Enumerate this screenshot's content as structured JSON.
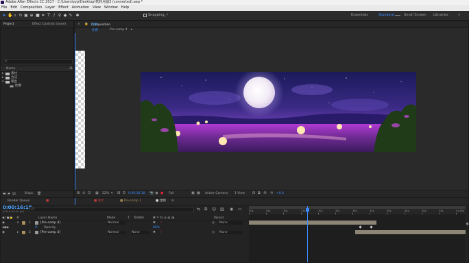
{
  "window": {
    "title": "Adobe After Effects CC 2017 - C:\\Users\\zyp\\Desktop\\花好月圆3 (converted).aep *"
  },
  "menu": [
    "File",
    "Edit",
    "Composition",
    "Layer",
    "Effect",
    "Animation",
    "View",
    "Window",
    "Help"
  ],
  "toolbar": {
    "snapping_label": "Snapping",
    "workspaces": [
      "Essentials",
      "Standard",
      "Small Screen",
      "Libraries"
    ],
    "active_workspace": "Standard"
  },
  "project_panel": {
    "tab_project": "Project",
    "tab_effect_controls": "Effect Controls (none)",
    "search_placeholder": "ρ-",
    "column_name": "Name",
    "items": [
      {
        "label": "素材",
        "type": "folder"
      },
      {
        "label": "合成",
        "type": "folder"
      },
      {
        "label": "输出",
        "type": "folder"
      },
      {
        "label": "比例",
        "type": "comp"
      }
    ],
    "bpc_label": "8 bpc"
  },
  "composition_panel": {
    "tab_label": "Composition",
    "comp_name": "比例",
    "breadcrumb_active": "比例",
    "breadcrumb_next": "Pre-comp 4",
    "zoom": "22%",
    "timecode": "0:00:16:18",
    "resolution": "Full",
    "camera": "Active Camera",
    "views": "1 View",
    "exposure": "+0.0"
  },
  "timeline": {
    "tabs": [
      {
        "label": "Render Queue"
      },
      {
        "label": "■"
      },
      {
        "label": "■ 英文"
      },
      {
        "label": "■ Pre-comp 1"
      },
      {
        "label": "■ 比例",
        "active": true
      }
    ],
    "timecode": "0:00:16:18",
    "frame_info": "00418 (25.00 fps)",
    "search_placeholder": "ρ-",
    "columns": {
      "layer_name": "Layer Name",
      "mode": "Mode",
      "trkmat": "TrkMat",
      "parent": "Parent"
    },
    "layers": [
      {
        "num": "1",
        "name": "[Pre-comp 4]",
        "mode": "Normal",
        "trkmat": "",
        "parent": "None"
      },
      {
        "num": "",
        "name": "Opacity",
        "value": "89%",
        "property": true
      },
      {
        "num": "2",
        "name": "[Pre-comp 4]",
        "mode": "Normal",
        "trkmat": "None",
        "parent": "None"
      }
    ],
    "ruler_ticks": [
      "00s",
      "05s",
      "10s",
      "15s",
      "20s",
      "25s",
      "30s",
      "35s",
      "40s",
      "45s",
      "50s",
      "55s",
      "01:00s"
    ],
    "current_time_fraction": 0.27,
    "layer_bars": [
      {
        "start_fraction": 0.0,
        "end_fraction": 0.59
      },
      {
        "start_fraction": 0.49,
        "end_fraction": 1.0
      }
    ],
    "keyframes_fraction": [
      0.51,
      0.56
    ]
  },
  "colors": {
    "accent_blue": "#3b8cff",
    "timecode_blue": "#4aa3ff",
    "bg_panel": "#232323",
    "layer_bar": "#8d8676",
    "label_red": "#c23b3b",
    "label_tan": "#a98d5b"
  }
}
